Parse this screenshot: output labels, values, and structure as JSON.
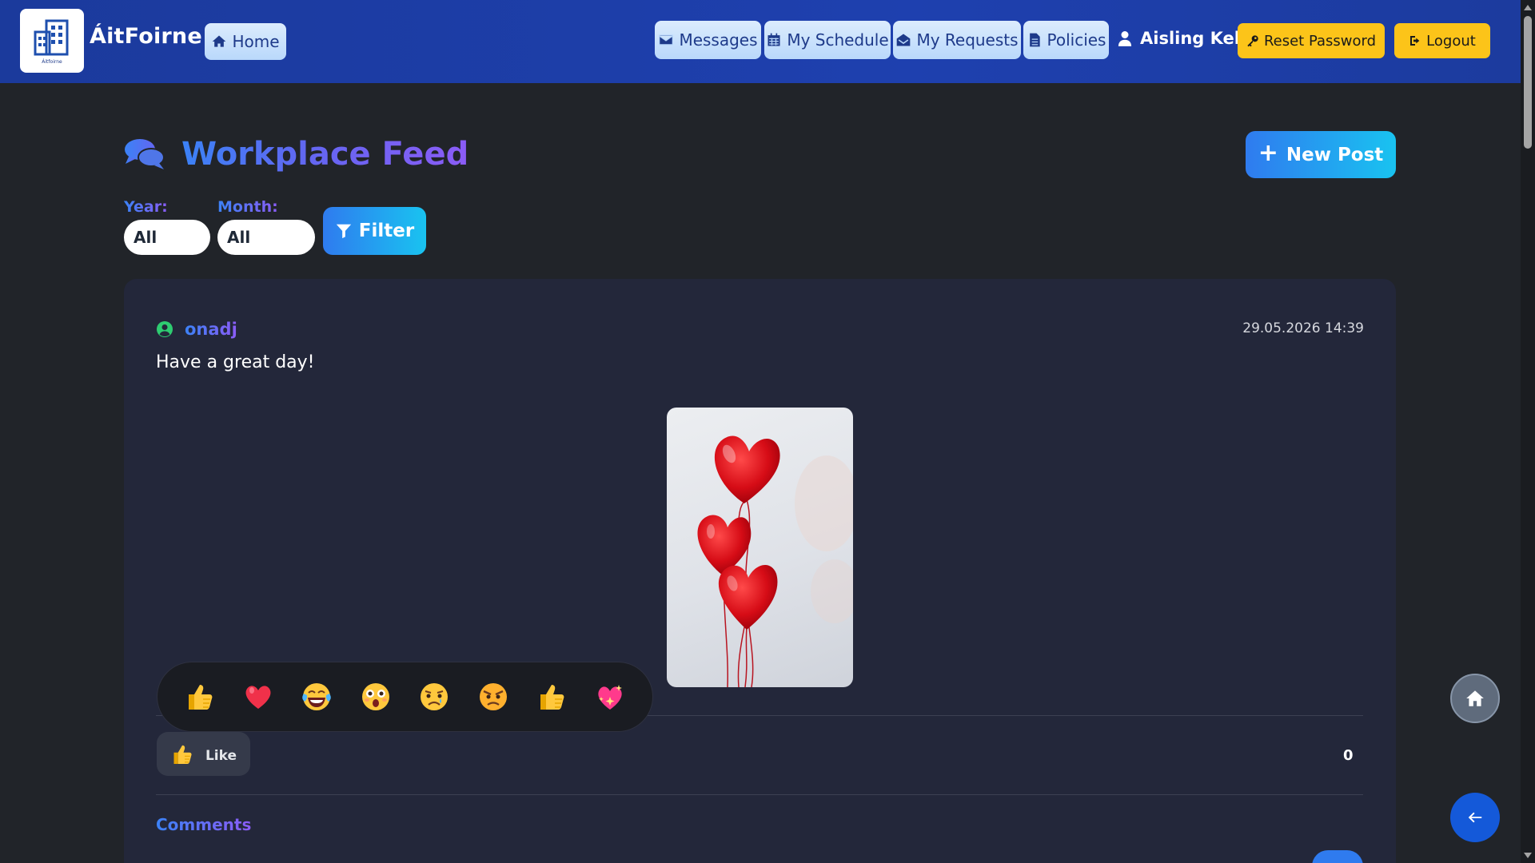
{
  "navbar": {
    "brand": "ÁitFoirne",
    "logo_caption": "Áitfoirne",
    "home_label": "Home",
    "messages_label": "Messages",
    "schedule_label": "My Schedule",
    "requests_label": "My Requests",
    "policies_label": "Policies",
    "user_name": "Aisling Kelly",
    "reset_label": "Reset Password",
    "logout_label": "Logout"
  },
  "page": {
    "title": "Workplace Feed",
    "new_post_label": "New Post"
  },
  "filters": {
    "year_label": "Year:",
    "year_value": "All",
    "month_label": "Month:",
    "month_value": "All",
    "filter_label": "Filter"
  },
  "post": {
    "author": "onadj",
    "date": "29.05.2026 14:39",
    "text": "Have a great day!",
    "image_icon": "heart-balloons-photo",
    "reactions": [
      "thumbs-up",
      "red-heart",
      "tears-of-joy",
      "astonished",
      "sad",
      "angry",
      "thumbs-up",
      "sparkling-heart"
    ],
    "like_label": "Like",
    "like_count": "0",
    "comments_title": "Comments"
  },
  "colors": {
    "navbar": "#1e40af",
    "background": "#212429",
    "card": "#23273a",
    "accent_yellow": "#fcc419",
    "accent_blue": "#2f7bef"
  }
}
